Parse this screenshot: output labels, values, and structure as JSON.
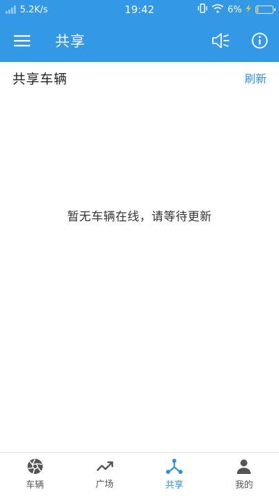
{
  "status_bar": {
    "network_speed": "5.2K/s",
    "time": "19:42",
    "battery_percent": "6%",
    "battery_level": 0.06
  },
  "app_bar": {
    "title": "共享",
    "menu_icon": "hamburger-menu-icon",
    "actions": [
      "speaker-mute-icon",
      "info-icon"
    ]
  },
  "section": {
    "title": "共享车辆",
    "refresh_label": "刷新"
  },
  "empty_state": {
    "message": "暂无车辆在线，请等待更新"
  },
  "tabs": [
    {
      "label": "车辆",
      "icon": "aperture-icon",
      "active": false
    },
    {
      "label": "广场",
      "icon": "trending-up-icon",
      "active": false
    },
    {
      "label": "共享",
      "icon": "share-nodes-icon",
      "active": true
    },
    {
      "label": "我的",
      "icon": "person-icon",
      "active": false
    }
  ],
  "colors": {
    "primary": "#3399e6",
    "accent": "#2f8fe0",
    "tab_inactive": "#555555"
  }
}
